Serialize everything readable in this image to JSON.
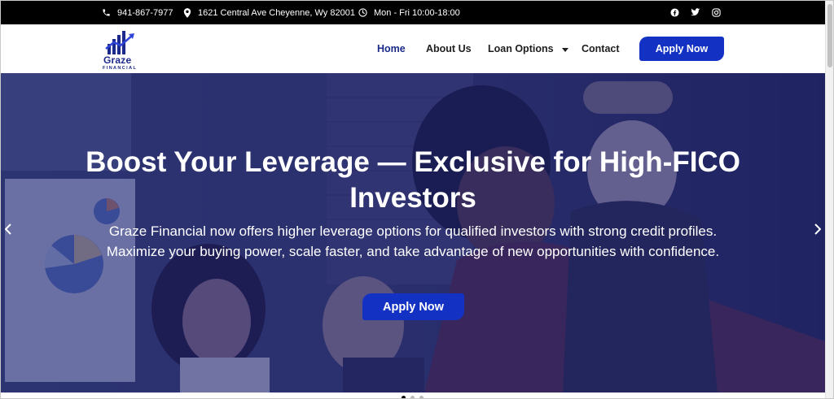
{
  "topbar": {
    "phone": "941-867-7977",
    "address": "1621 Central Ave Cheyenne, Wy 82001",
    "hours": "Mon - Fri 10:00-18:00",
    "social": [
      "facebook-icon",
      "twitter-icon",
      "instagram-icon"
    ]
  },
  "logo": {
    "name": "Graze",
    "tagline": "FINANCIAL"
  },
  "nav": {
    "items": [
      {
        "label": "Home",
        "active": true
      },
      {
        "label": "About Us"
      },
      {
        "label": "Loan Options",
        "has_dropdown": true
      },
      {
        "label": "Contact"
      }
    ],
    "cta_label": "Apply Now"
  },
  "hero": {
    "title": "Boost Your Leverage — Exclusive for High-FICO Investors",
    "body": "Graze Financial now offers higher leverage options for qualified investors with strong credit profiles. Maximize your buying power, scale faster, and take advantage of new opportunities with confidence.",
    "cta_label": "Apply Now",
    "slide_count": 3,
    "active_slide": 1
  },
  "colors": {
    "brand_blue": "#1332c4",
    "logo_navy": "#1c2a8c",
    "topbar_bg": "#000000"
  }
}
